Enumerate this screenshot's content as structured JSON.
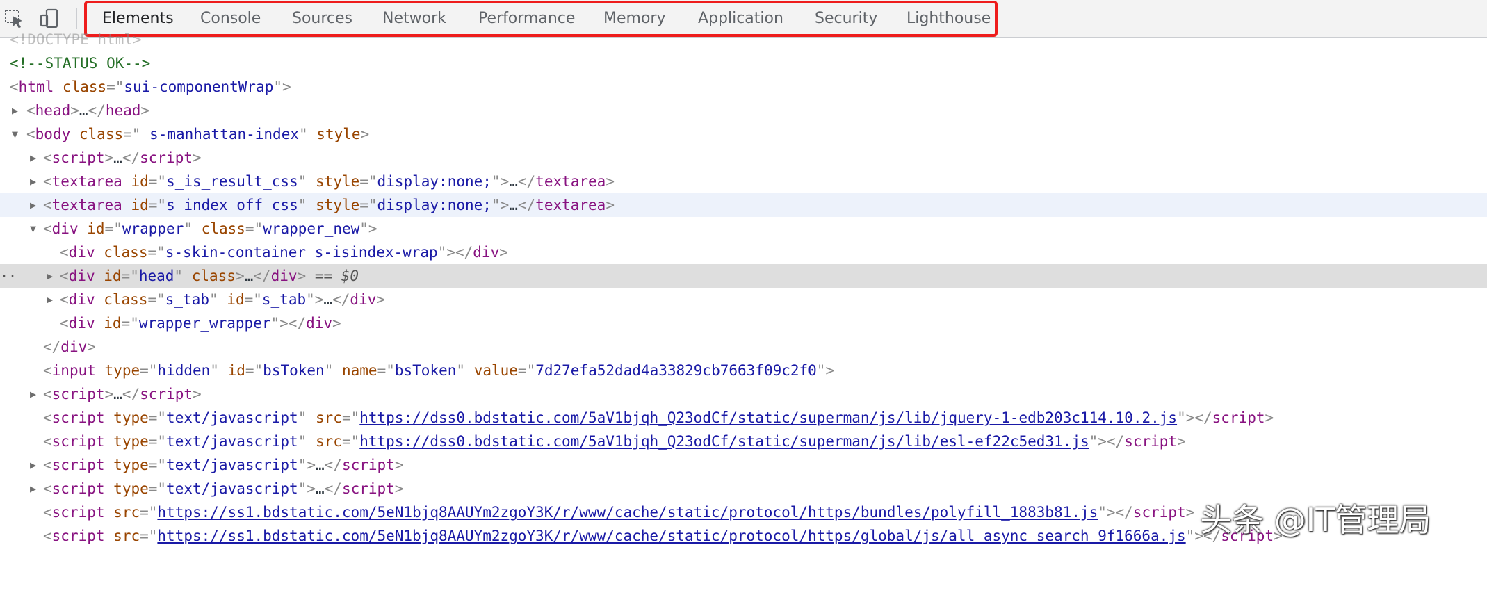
{
  "devtools": {
    "toolbar": {
      "icons": [
        "inspect-element-icon",
        "device-toolbar-icon"
      ],
      "tabs": [
        "Elements",
        "Console",
        "Sources",
        "Network",
        "Performance",
        "Memory",
        "Application",
        "Security",
        "Lighthouse"
      ],
      "active_tab": "Elements",
      "highlight_color": "#ee1c1c"
    },
    "dom_tree": {
      "doctype": "<!DOCTYPE html>",
      "comment": "<!--STATUS OK-->",
      "html_tag": "html",
      "html_class": "sui-componentWrap",
      "head_tag": "head",
      "body_tag": "body",
      "body_class": " s-manhattan-index",
      "body_extra_attr": "style",
      "script_tag": "script",
      "textarea_tag": "textarea",
      "div_tag": "div",
      "input_tag": "input",
      "attr_id": "id",
      "attr_class": "class",
      "attr_style": "style",
      "attr_type": "type",
      "attr_name": "name",
      "attr_value": "value",
      "attr_src": "src",
      "ta1_id": "s_is_result_css",
      "ta2_id": "s_index_off_css",
      "ta_style": "display:none;",
      "wrapper_id": "wrapper",
      "wrapper_class": "wrapper_new",
      "skin_class": "s-skin-container s-isindex-wrap",
      "head_div_id": "head",
      "selected_marker": "== $0",
      "tab_class": "s_tab",
      "tab_id": "s_tab",
      "wrapper_wrapper_id": "wrapper_wrapper",
      "input_type": "hidden",
      "input_id": "bsToken",
      "input_name": "bsToken",
      "input_value": "7d27efa52dad4a33829cb7663f09c2f0",
      "js_type": "text/javascript",
      "src_jquery": "https://dss0.bdstatic.com/5aV1bjqh_Q23odCf/static/superman/js/lib/jquery-1-edb203c114.10.2.js",
      "src_esl": "https://dss0.bdstatic.com/5aV1bjqh_Q23odCf/static/superman/js/lib/esl-ef22c5ed31.js",
      "src_polyfill": "https://ss1.bdstatic.com/5eN1bjq8AAUYm2zgoY3K/r/www/cache/static/protocol/https/bundles/polyfill_1883b81.js",
      "src_async": "https://ss1.bdstatic.com/5eN1bjq8AAUYm2zgoY3K/r/www/cache/static/protocol/https/global/js/all_async_search_9f1666a.js"
    },
    "watermark": "头条 @IT管理局"
  }
}
